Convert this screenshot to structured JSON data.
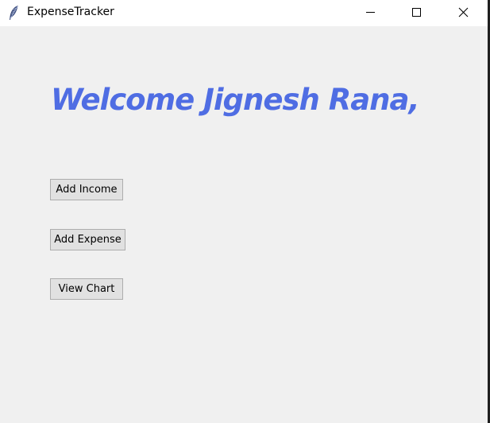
{
  "window": {
    "title": "ExpenseTracker",
    "icon": "feather-icon",
    "controls": [
      "minimize-icon",
      "maximize-icon",
      "close-icon"
    ]
  },
  "main": {
    "welcome_text": "Welcome Jignesh Rana,",
    "buttons": {
      "add_income": "Add Income",
      "add_expense": "Add Expense",
      "view_chart": "View Chart"
    }
  },
  "colors": {
    "welcome_text": "#4f6de3",
    "background": "#f0f0f0",
    "button_face": "#e1e1e1",
    "button_border": "#adadad"
  }
}
